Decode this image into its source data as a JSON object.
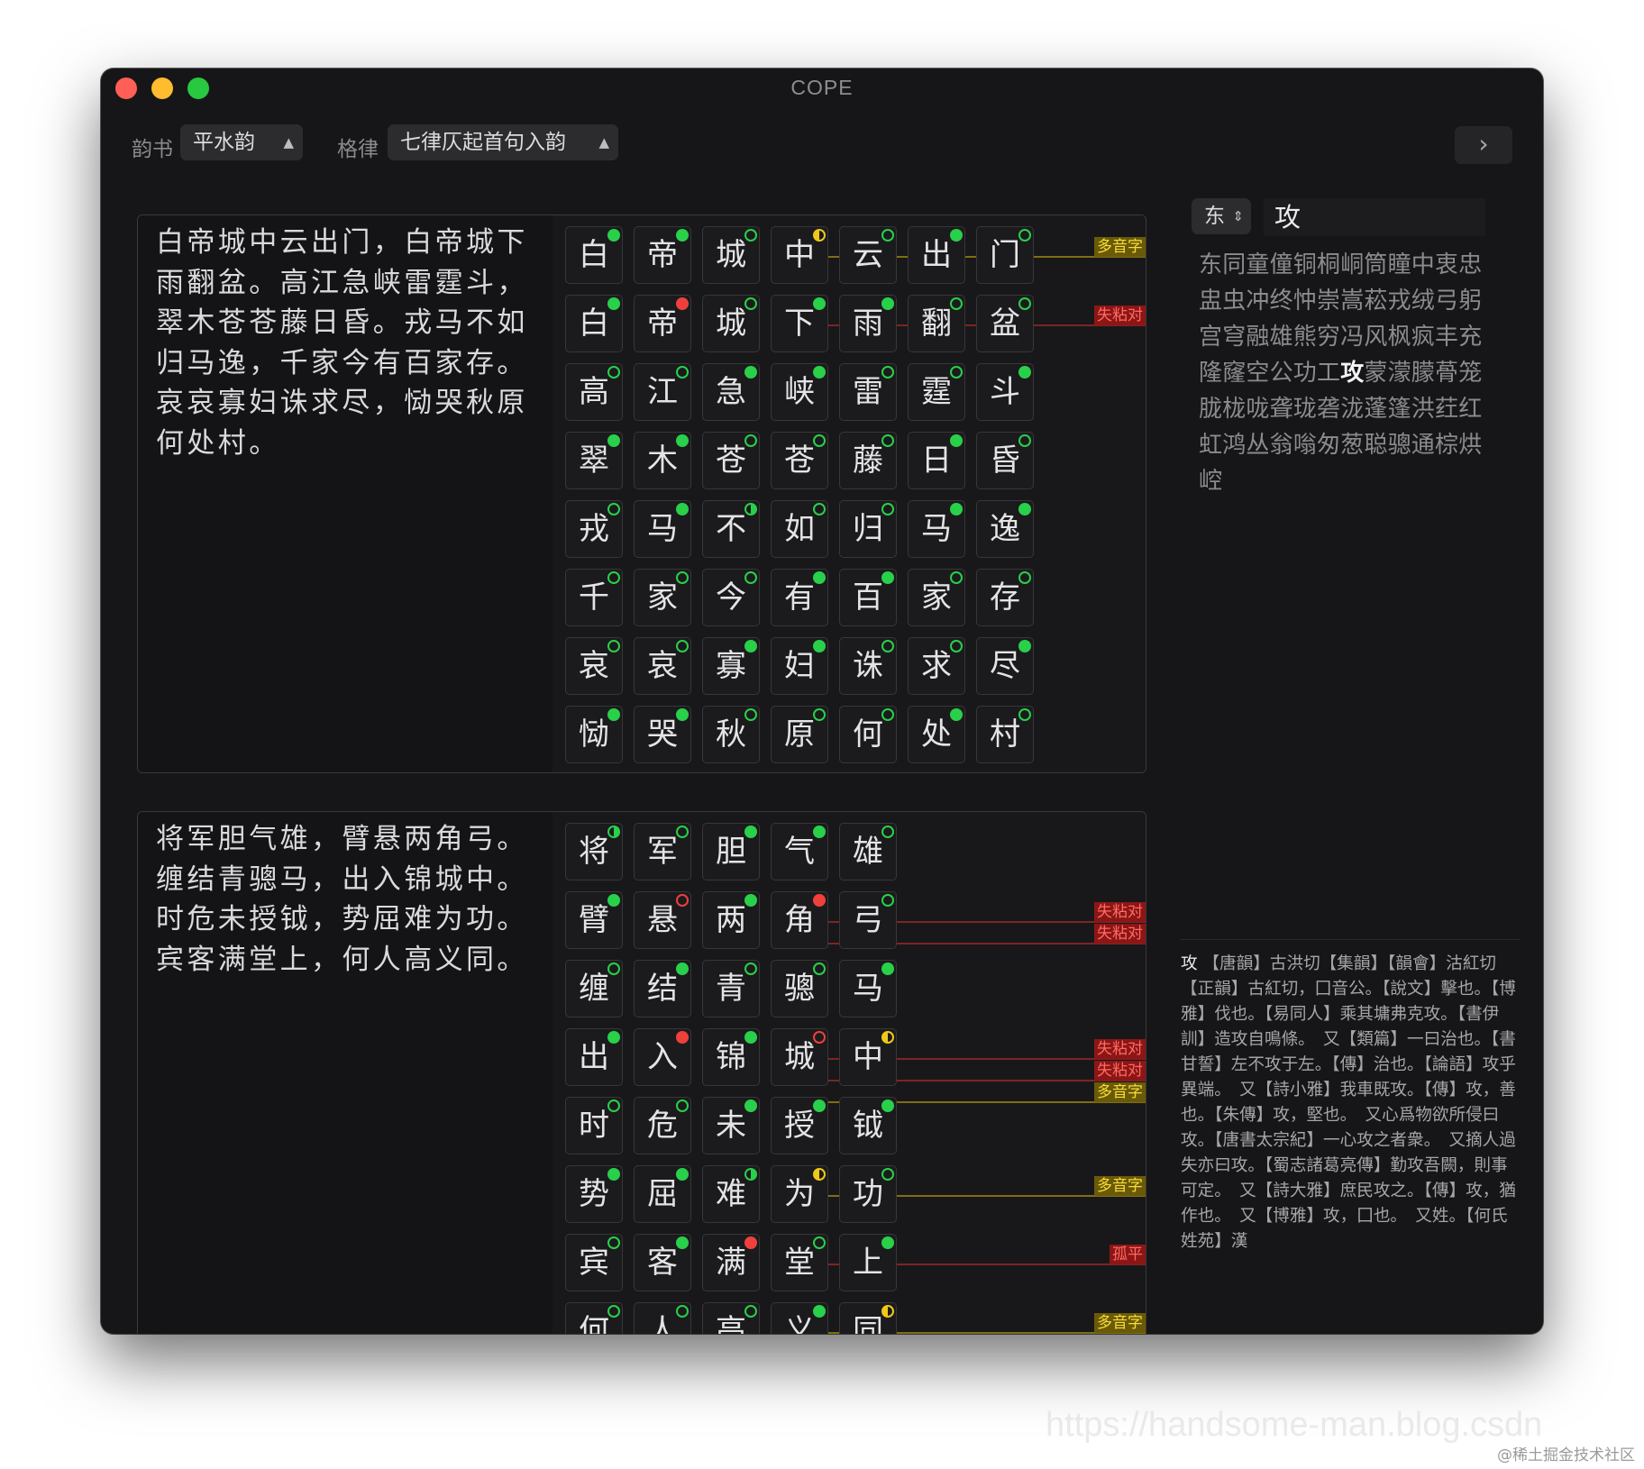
{
  "window": {
    "title": "COPE",
    "traffic_lights": {
      "close": "#ff5f57",
      "minimize": "#febc2e",
      "zoom": "#28c840"
    }
  },
  "toolbar": {
    "rhyme_book_label": "韵书",
    "rhyme_book_value": "平水韵",
    "meter_label": "格律",
    "meter_value": "七律仄起首句入韵",
    "forward_icon": "chevron-right-icon"
  },
  "legend_colors": {
    "level_tone": "#29d04a",
    "violation": "#f0403c",
    "polyphonic": "#f0c818"
  },
  "poems": [
    {
      "text": "白帝城中云出门，白帝城下雨翻盆。高江急峡雷霆斗，翠木苍苍藤日昏。戎马不如归马逸，千家今有百家存。哀哀寡妇诛求尽，恸哭秋原何处村。",
      "cols": 7,
      "rows": [
        {
          "chars": [
            "白",
            "帝",
            "城",
            "中",
            "云",
            "出",
            "门"
          ],
          "marks": [
            "g",
            "g",
            "go",
            "y",
            "go",
            "g",
            "go"
          ]
        },
        {
          "chars": [
            "白",
            "帝",
            "城",
            "下",
            "雨",
            "翻",
            "盆"
          ],
          "marks": [
            "g",
            "r",
            "go",
            "g",
            "g",
            "go",
            "go"
          ]
        },
        {
          "chars": [
            "高",
            "江",
            "急",
            "峡",
            "雷",
            "霆",
            "斗"
          ],
          "marks": [
            "go",
            "go",
            "g",
            "g",
            "go",
            "go",
            "g"
          ]
        },
        {
          "chars": [
            "翠",
            "木",
            "苍",
            "苍",
            "藤",
            "日",
            "昏"
          ],
          "marks": [
            "g",
            "g",
            "go",
            "go",
            "go",
            "g",
            "go"
          ]
        },
        {
          "chars": [
            "戎",
            "马",
            "不",
            "如",
            "归",
            "马",
            "逸"
          ],
          "marks": [
            "go",
            "g",
            "gh",
            "go",
            "go",
            "g",
            "g"
          ]
        },
        {
          "chars": [
            "千",
            "家",
            "今",
            "有",
            "百",
            "家",
            "存"
          ],
          "marks": [
            "go",
            "go",
            "go",
            "g",
            "g",
            "go",
            "go"
          ]
        },
        {
          "chars": [
            "哀",
            "哀",
            "寡",
            "妇",
            "诛",
            "求",
            "尽"
          ],
          "marks": [
            "go",
            "go",
            "g",
            "g",
            "go",
            "go",
            "g"
          ]
        },
        {
          "chars": [
            "恸",
            "哭",
            "秋",
            "原",
            "何",
            "处",
            "村"
          ],
          "marks": [
            "g",
            "g",
            "go",
            "go",
            "go",
            "g",
            "go"
          ]
        }
      ],
      "tags": [
        {
          "row": 0,
          "label": "多音字",
          "kind": "y"
        },
        {
          "row": 1,
          "label": "失粘对",
          "kind": "r"
        }
      ]
    },
    {
      "text": "将军胆气雄，臂悬两角弓。缠结青骢马，出入锦城中。时危未授钺，势屈难为功。宾客满堂上，何人高义同。",
      "cols": 5,
      "rows": [
        {
          "chars": [
            "将",
            "军",
            "胆",
            "气",
            "雄"
          ],
          "marks": [
            "gh",
            "go",
            "g",
            "g",
            "go"
          ]
        },
        {
          "chars": [
            "臂",
            "悬",
            "两",
            "角",
            "弓"
          ],
          "marks": [
            "g",
            "ro",
            "g",
            "r",
            "go"
          ]
        },
        {
          "chars": [
            "缠",
            "结",
            "青",
            "骢",
            "马"
          ],
          "marks": [
            "go",
            "g",
            "go",
            "go",
            "g"
          ]
        },
        {
          "chars": [
            "出",
            "入",
            "锦",
            "城",
            "中"
          ],
          "marks": [
            "g",
            "r",
            "g",
            "ro",
            "y"
          ]
        },
        {
          "chars": [
            "时",
            "危",
            "未",
            "授",
            "钺"
          ],
          "marks": [
            "go",
            "go",
            "g",
            "g",
            "g"
          ]
        },
        {
          "chars": [
            "势",
            "屈",
            "难",
            "为",
            "功"
          ],
          "marks": [
            "g",
            "g",
            "gh",
            "y",
            "go"
          ]
        },
        {
          "chars": [
            "宾",
            "客",
            "满",
            "堂",
            "上"
          ],
          "marks": [
            "go",
            "g",
            "r",
            "go",
            "g"
          ]
        },
        {
          "chars": [
            "何",
            "人",
            "高",
            "义",
            "同"
          ],
          "marks": [
            "go",
            "go",
            "go",
            "g",
            "y"
          ]
        }
      ],
      "tags": [
        {
          "row": 1,
          "label": "失粘对",
          "kind": "r"
        },
        {
          "row": 1,
          "label": "失粘对",
          "kind": "r"
        },
        {
          "row": 3,
          "label": "失粘对",
          "kind": "r"
        },
        {
          "row": 3,
          "label": "失粘对",
          "kind": "r"
        },
        {
          "row": 3,
          "label": "多音字",
          "kind": "y"
        },
        {
          "row": 5,
          "label": "多音字",
          "kind": "y"
        },
        {
          "row": 6,
          "label": "孤平",
          "kind": "r"
        },
        {
          "row": 7,
          "label": "多音字",
          "kind": "y"
        }
      ]
    }
  ],
  "rhyme_panel": {
    "group_value": "东",
    "search_value": "攻",
    "chars_before": "东同童僮铜桐峒筒瞳中衷忠盅虫冲终忡崇嵩菘戎绒弓躬宫穹融雄熊穷冯风枫疯丰充隆窿空公功工",
    "highlight": "攻",
    "chars_after": "蒙濛朦蓇笼胧栊咙聋珑砻泷蓬篷洪荭红虹鸿丛翁嗡匆葱聪骢通棕烘崆"
  },
  "definition": {
    "head": "攻",
    "body": " 【唐韻】古洪切【集韻】【韻會】沽紅切【正韻】古紅切，囗音公。【說文】擊也。【博雅】伐也。【易同人】乘其墉弗克攻。【書伊訓】造攻自鳴條。　又【類篇】一曰治也。【書甘誓】左不攻于左。【傳】治也。【論語】攻乎異端。　又【詩小雅】我車既攻。【傳】攻，善也。【朱傳】攻，堅也。　又心爲物欲所侵曰攻。【唐書太宗紀】一心攻之者衆。　又摘人過失亦曰攻。【蜀志諸葛亮傳】勤攻吾闕，則事可定。　又【詩大雅】庶民攻之。【傳】攻，猶作也。　又【博雅】攻，囗也。　又姓。【何氏姓苑】漢"
  },
  "watermark": "https://handsome-man.blog.csdn",
  "credit": "@稀土掘金技术社区"
}
